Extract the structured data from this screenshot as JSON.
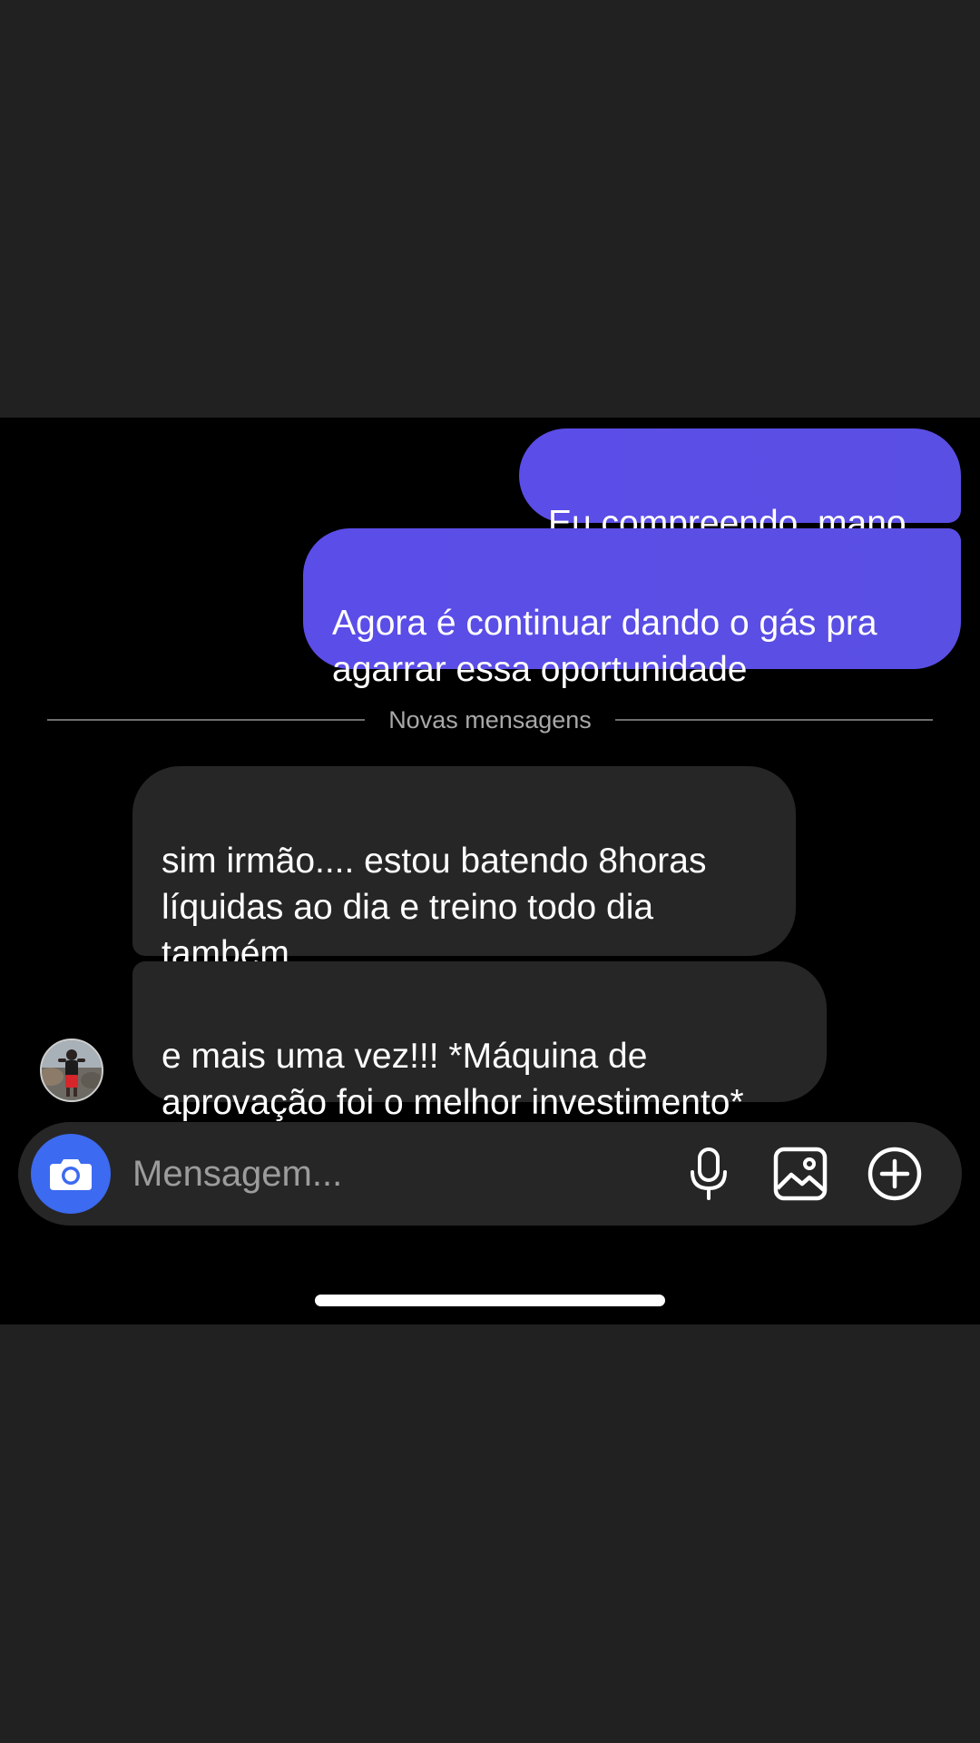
{
  "messages": {
    "outgoing": [
      {
        "text": "Eu compreendo, mano"
      },
      {
        "text": "Agora é continuar dando o gás pra\nagarrar essa oportunidade"
      }
    ],
    "incoming": [
      {
        "text": "sim irmão.... estou batendo 8horas\nlíquidas ao dia e treino todo dia\ntambém"
      },
      {
        "text": "e mais uma vez!!! *Máquina de\naprovação foi o melhor investimento*"
      }
    ]
  },
  "divider": {
    "label": "Novas mensagens"
  },
  "composer": {
    "placeholder": "Mensagem...",
    "camera_icon": "camera-icon",
    "mic_icon": "microphone-icon",
    "gallery_icon": "image-icon",
    "plus_icon": "plus-circle-icon"
  },
  "colors": {
    "outgoing_bubble": "#5b4de8",
    "incoming_bubble": "#262626",
    "camera_button": "#3c6af0",
    "background": "#000000",
    "letterbox": "#212121"
  }
}
